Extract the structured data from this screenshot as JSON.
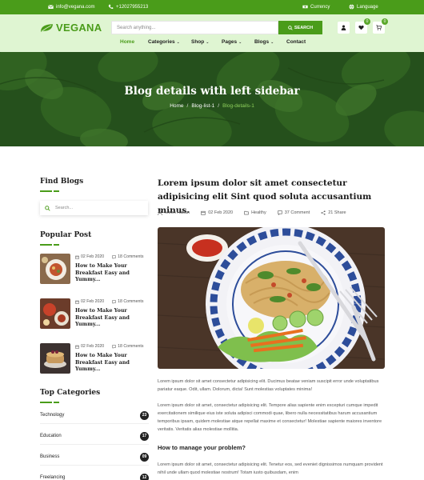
{
  "topbar": {
    "email": "info@vegana.com",
    "phone": "+12027955213",
    "currency": "Currency",
    "language": "Language"
  },
  "header": {
    "logo_text": "VEGANA",
    "search_placeholder": "Search anything...",
    "search_button": "SEARCH",
    "wishlist_count": "0",
    "cart_count": "0"
  },
  "nav": {
    "items": [
      {
        "label": "Home"
      },
      {
        "label": "Categories"
      },
      {
        "label": "Shop"
      },
      {
        "label": "Pages"
      },
      {
        "label": "Blogs"
      },
      {
        "label": "Contact"
      }
    ]
  },
  "hero": {
    "title": "Blog details with left sidebar",
    "breadcrumbs": [
      "Home",
      "Blog-list-1",
      "Blog-details-1"
    ]
  },
  "sidebar": {
    "find_heading": "Find Blogs",
    "search_placeholder": "Search...",
    "popular_heading": "Popular Post",
    "posts": [
      {
        "date": "02 Feb 2020",
        "comments": "18 Comments",
        "title": "How to Make Your Breakfast Easy and Yummy..."
      },
      {
        "date": "02 Feb 2020",
        "comments": "18 Comments",
        "title": "How to Make Your Breakfast Easy and Yummy..."
      },
      {
        "date": "02 Feb 2020",
        "comments": "18 Comments",
        "title": "How to Make Your Breakfast Easy and Yummy..."
      }
    ],
    "categories_heading": "Top Categories",
    "categories": [
      {
        "name": "Technology",
        "count": "23"
      },
      {
        "name": "Education",
        "count": "17"
      },
      {
        "name": "Business",
        "count": "09"
      },
      {
        "name": "Freelancing",
        "count": "12"
      }
    ]
  },
  "post": {
    "title": "Lorem ipsum dolor sit amet consectetur adipisicing elit Sint quod soluta accusantium minus.",
    "author": "Miron Hasan",
    "date": "02 Feb 2020",
    "category": "Healthy",
    "comments": "37 Comment",
    "shares": "21 Share",
    "para1": "Lorem ipsum dolor sit amet consectetur adipisicing elit. Ducimus beatae veniam suscipit error unde voluptatibus pariatur eaque. Odit, ullam. Dolorum, dicta! Sunt molestias voluptates minima!",
    "para2": "Lorem ipsum dolor sit amet, consectetur adipisicing elit. Tempore alias sapiente enim excepturi cumque impedit exercitationem similique eius iste soluta adipisci commodi quae, libero nulla necessitatibus harum accusantium temporibus ipsam, quidem molestiae atque repellat maxime et consectetur! Molestiae sapiente maiores inventore veritatis. Veritatis alias molestiae mollitia.",
    "subheading": "How to manage your problem?",
    "para3": "Lorem ipsum dolor sit amet, consectetur adipisicing elit. Tenetur eos, sed eveniet dignissimos numquam provident nihil unde ullam quod molestiae nostrum! Totam iusto quibusdam, enim"
  },
  "colors": {
    "brand_green": "#4a9c1a",
    "header_bg": "#dff5d2"
  }
}
